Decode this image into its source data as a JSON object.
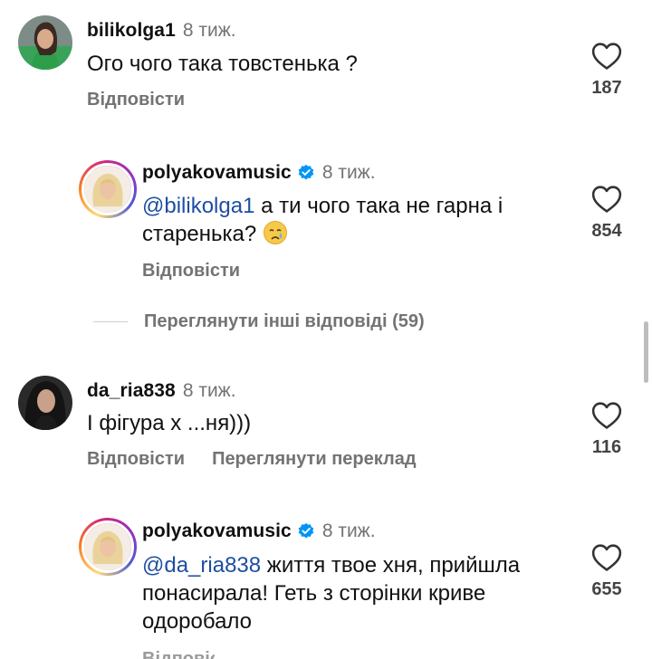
{
  "comments": [
    {
      "username": "bilikolga1",
      "time": "8 тиж.",
      "text": "Ого чого така товстенька ?",
      "reply_label": "Відповісти",
      "likes": "187"
    },
    {
      "username": "polyakovamusic",
      "time": "8 тиж.",
      "mention": "@bilikolga1",
      "text": " а ти чого така не гарна і старенька?",
      "reply_label": "Відповісти",
      "likes": "854"
    },
    {
      "username": "da_ria838",
      "time": "8 тиж.",
      "text": "І фігура х ...ня)))",
      "reply_label": "Відповісти",
      "translate_label": "Переглянути переклад",
      "likes": "116"
    },
    {
      "username": "polyakovamusic",
      "time": "8 тиж.",
      "mention": "@da_ria838",
      "text": " життя твое хня, прийшла понасирала! Геть з сторінки криве одоробало",
      "reply_label": "Відповісти",
      "likes": "655"
    }
  ],
  "view_more_replies": "Переглянути інші відповіді (59)",
  "icons": {
    "like": "heart-outline-icon",
    "verified": "verified-badge-icon",
    "emoji": "crying-face-emoji"
  },
  "colors": {
    "verified": "#0095f6",
    "mention": "#1e4ea0",
    "muted": "#737373"
  }
}
